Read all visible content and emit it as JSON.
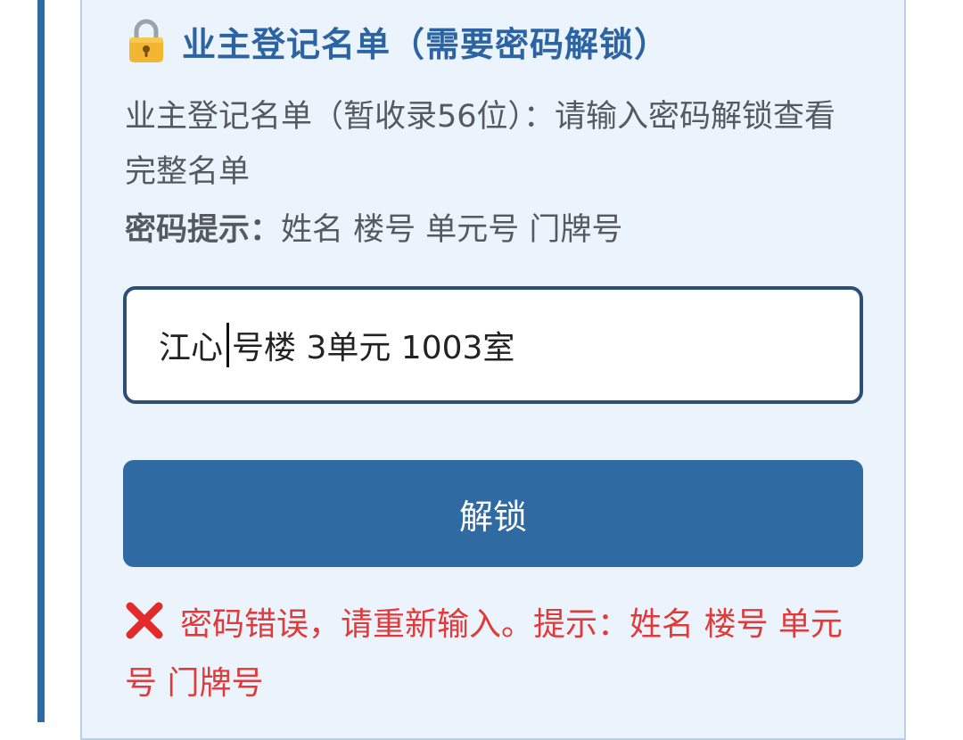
{
  "panel": {
    "title": "业主登记名单（需要密码解锁）",
    "icon": "lock-icon",
    "description": "业主登记名单（暂收录56位）：请输入密码解锁查看完整名单",
    "hint_label": "密码提示：",
    "hint_text": "姓名 楼号 单元号 门牌号"
  },
  "password_input": {
    "value_before_caret": "江心",
    "value_after_caret": "号楼 3单元 1003室"
  },
  "unlock_button": {
    "label": "解锁"
  },
  "error": {
    "icon": "x-icon",
    "message": "密码错误，请重新输入。提示：姓名 楼号 单元号 门牌号"
  },
  "colors": {
    "accent": "#2f6aa3",
    "card_bg": "#ebf3fc",
    "title": "#2c63a3",
    "error": "#e03a3a",
    "text": "#555a60"
  }
}
